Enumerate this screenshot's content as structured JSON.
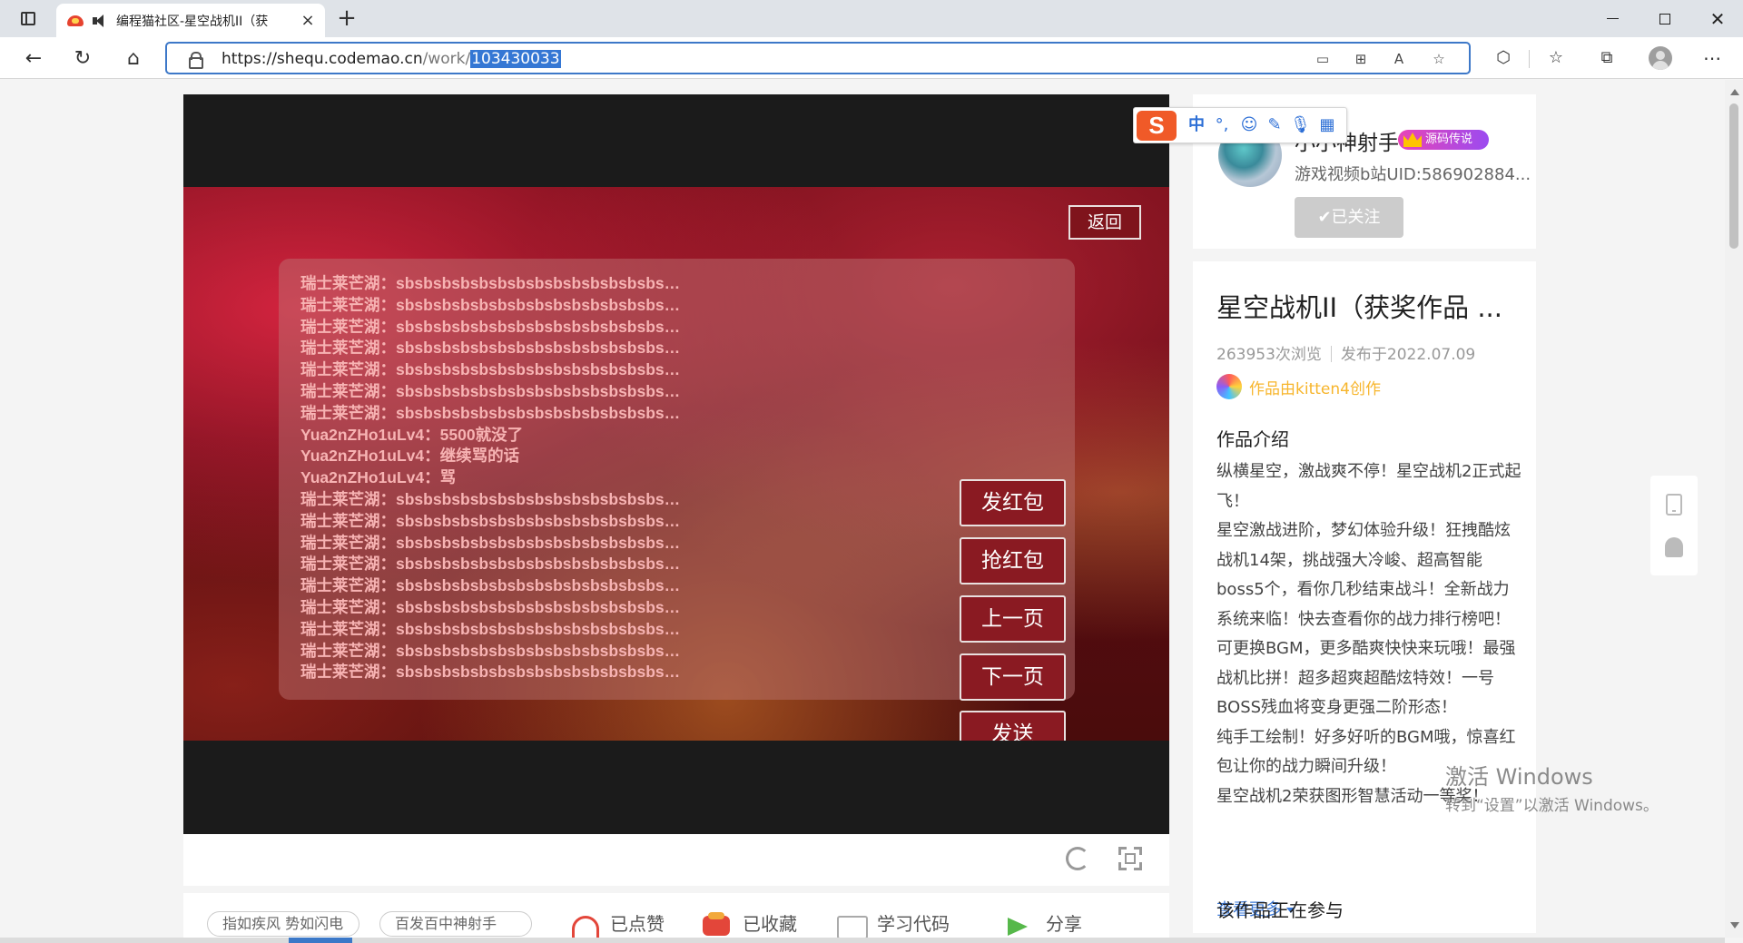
{
  "browser": {
    "tab_title": "编程猫社区-星空战机II（获",
    "url_host": "https://shequ.codemao.cn",
    "url_path": "/work/",
    "url_selected": "103430033"
  },
  "game": {
    "back_label": "返回",
    "chat_lines": [
      "瑞士莱芒湖：sbsbsbsbsbsbsbsbsbsbsbsbsbsbs…",
      "瑞士莱芒湖：sbsbsbsbsbsbsbsbsbsbsbsbsbsbs…",
      "瑞士莱芒湖：sbsbsbsbsbsbsbsbsbsbsbsbsbsbs…",
      "瑞士莱芒湖：sbsbsbsbsbsbsbsbsbsbsbsbsbsbs…",
      "瑞士莱芒湖：sbsbsbsbsbsbsbsbsbsbsbsbsbsbs…",
      "瑞士莱芒湖：sbsbsbsbsbsbsbsbsbsbsbsbsbsbs…",
      "瑞士莱芒湖：sbsbsbsbsbsbsbsbsbsbsbsbsbsbs…",
      "Yua2nZHo1uLv4：5500就没了",
      "Yua2nZHo1uLv4：继续骂的话",
      "Yua2nZHo1uLv4：骂",
      "瑞士莱芒湖：sbsbsbsbsbsbsbsbsbsbsbsbsbsbs…",
      "瑞士莱芒湖：sbsbsbsbsbsbsbsbsbsbsbsbsbsbs…",
      "瑞士莱芒湖：sbsbsbsbsbsbsbsbsbsbsbsbsbsbs…",
      "瑞士莱芒湖：sbsbsbsbsbsbsbsbsbsbsbsbsbsbs…",
      "瑞士莱芒湖：sbsbsbsbsbsbsbsbsbsbsbsbsbsbs…",
      "瑞士莱芒湖：sbsbsbsbsbsbsbsbsbsbsbsbsbsbs…",
      "瑞士莱芒湖：sbsbsbsbsbsbsbsbsbsbsbsbsbsbs…",
      "瑞士莱芒湖：sbsbsbsbsbsbsbsbsbsbsbsbsbsbs…",
      "瑞士莱芒湖：sbsbsbsbsbsbsbsbsbsbsbsbsbsbs…"
    ],
    "buttons": [
      "发红包",
      "抢红包",
      "上一页",
      "下一页",
      "发送"
    ]
  },
  "actions": {
    "tag1": "指如疾风 势如闪电",
    "tag2": "百发百中神射手",
    "like": "已点赞",
    "favorite": "已收藏",
    "code": "学习代码",
    "share": "分享"
  },
  "author": {
    "name": "小小神射手",
    "badge": "源码传说",
    "desc": "游戏视频b站UID:586902884...",
    "follow": "✔已关注"
  },
  "work": {
    "title": "星空战机II（获奖作品 ...",
    "views": "263953次浏览",
    "published": "发布于2022.07.09",
    "made_with": "作品由kitten4创作",
    "intro_heading": "作品介绍",
    "intro_lines": [
      "纵横星空，激战爽不停！星空战机2正式起",
      "飞！",
      "星空激战进阶，梦幻体验升级！狂拽酷炫",
      "战机14架，挑战强大冷峻、超高智能",
      "boss5个，看你几秒结束战斗！全新战力",
      "系统来临！快去查看你的战力排行榜吧！",
      "可更换BGM，更多酷爽快快来玩哦！最强",
      "战机比拼！超多超爽超酷炫特效！一号",
      "BOSS残血将变身更强二阶形态！",
      "纯手工绘制！好多好听的BGM哦，惊喜红",
      "包让你的战力瞬间升级！",
      "星空战机2荣获图形智慧活动一等奖！"
    ],
    "see_more": "查看更多",
    "activity_heading": "该作品正在参与"
  },
  "watermark": {
    "line1": "激活 Windows",
    "line2": "转到“设置”以激活 Windows。"
  },
  "ime": {
    "logo": "S",
    "mode": "中"
  }
}
